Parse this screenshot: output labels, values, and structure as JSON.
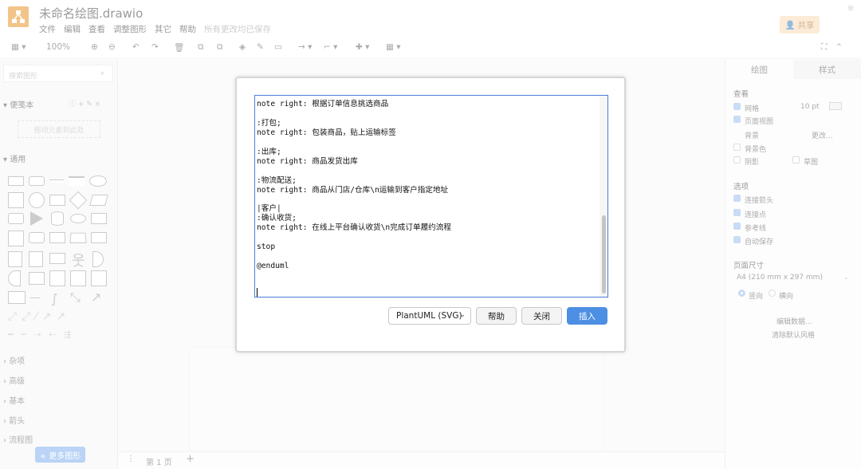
{
  "app": {
    "title": "未命名绘图.drawio",
    "menu": [
      "文件",
      "编辑",
      "查看",
      "调整图形",
      "其它",
      "帮助"
    ],
    "save_status": "所有更改均已保存",
    "share_label": "共享"
  },
  "toolbar": {
    "zoom": "100%"
  },
  "left_panel": {
    "search_placeholder": "搜索图形",
    "scratchpad_label": "便笺本",
    "scratchpad_drop": "拖动元素到此处",
    "general_label": "通用",
    "categories": [
      "杂项",
      "高级",
      "基本",
      "箭头",
      "流程图"
    ],
    "more_shapes": "+ 更多图形"
  },
  "page_tab": {
    "label": "第 1 页"
  },
  "right_panel": {
    "tabs": [
      "绘图",
      "样式"
    ],
    "view_section": "查看",
    "grid_label": "网格",
    "grid_size": "10 pt",
    "page_view_label": "页面视图",
    "background_label": "背景",
    "change_label": "更改...",
    "bg_color_label": "背景色",
    "shadow_label": "阴影",
    "sketch_label": "草图",
    "options_section": "选项",
    "options": [
      "连接箭头",
      "连接点",
      "参考线",
      "自动保存"
    ],
    "paper_section": "页面尺寸",
    "paper_size": "A4 (210 mm x 297 mm)",
    "portrait": "竖向",
    "landscape": "横向",
    "edit_data": "编辑数据...",
    "clear_style": "清除默认风格"
  },
  "dialog": {
    "code_lines": [
      "note right: 根据订单信息挑选商品",
      "",
      ":打包;",
      "note right: 包装商品，贴上运输标签",
      "",
      ":出库;",
      "note right: 商品发货出库",
      "",
      ":物流配送;",
      "note right: 商品从门店/仓库\\n运输到客户指定地址",
      "",
      "|客户|",
      ":确认收货;",
      "note right: 在线上平台确认收货\\n完成订单履约流程",
      "",
      "stop",
      "",
      "@enduml"
    ],
    "format_selected": "PlantUML (SVG)",
    "help_button": "帮助",
    "close_button": "关闭",
    "insert_button": "插入"
  },
  "colors": {
    "accent": "#4d8fe3",
    "editor_border": "#4a7fd6",
    "logo": "#f08705"
  }
}
